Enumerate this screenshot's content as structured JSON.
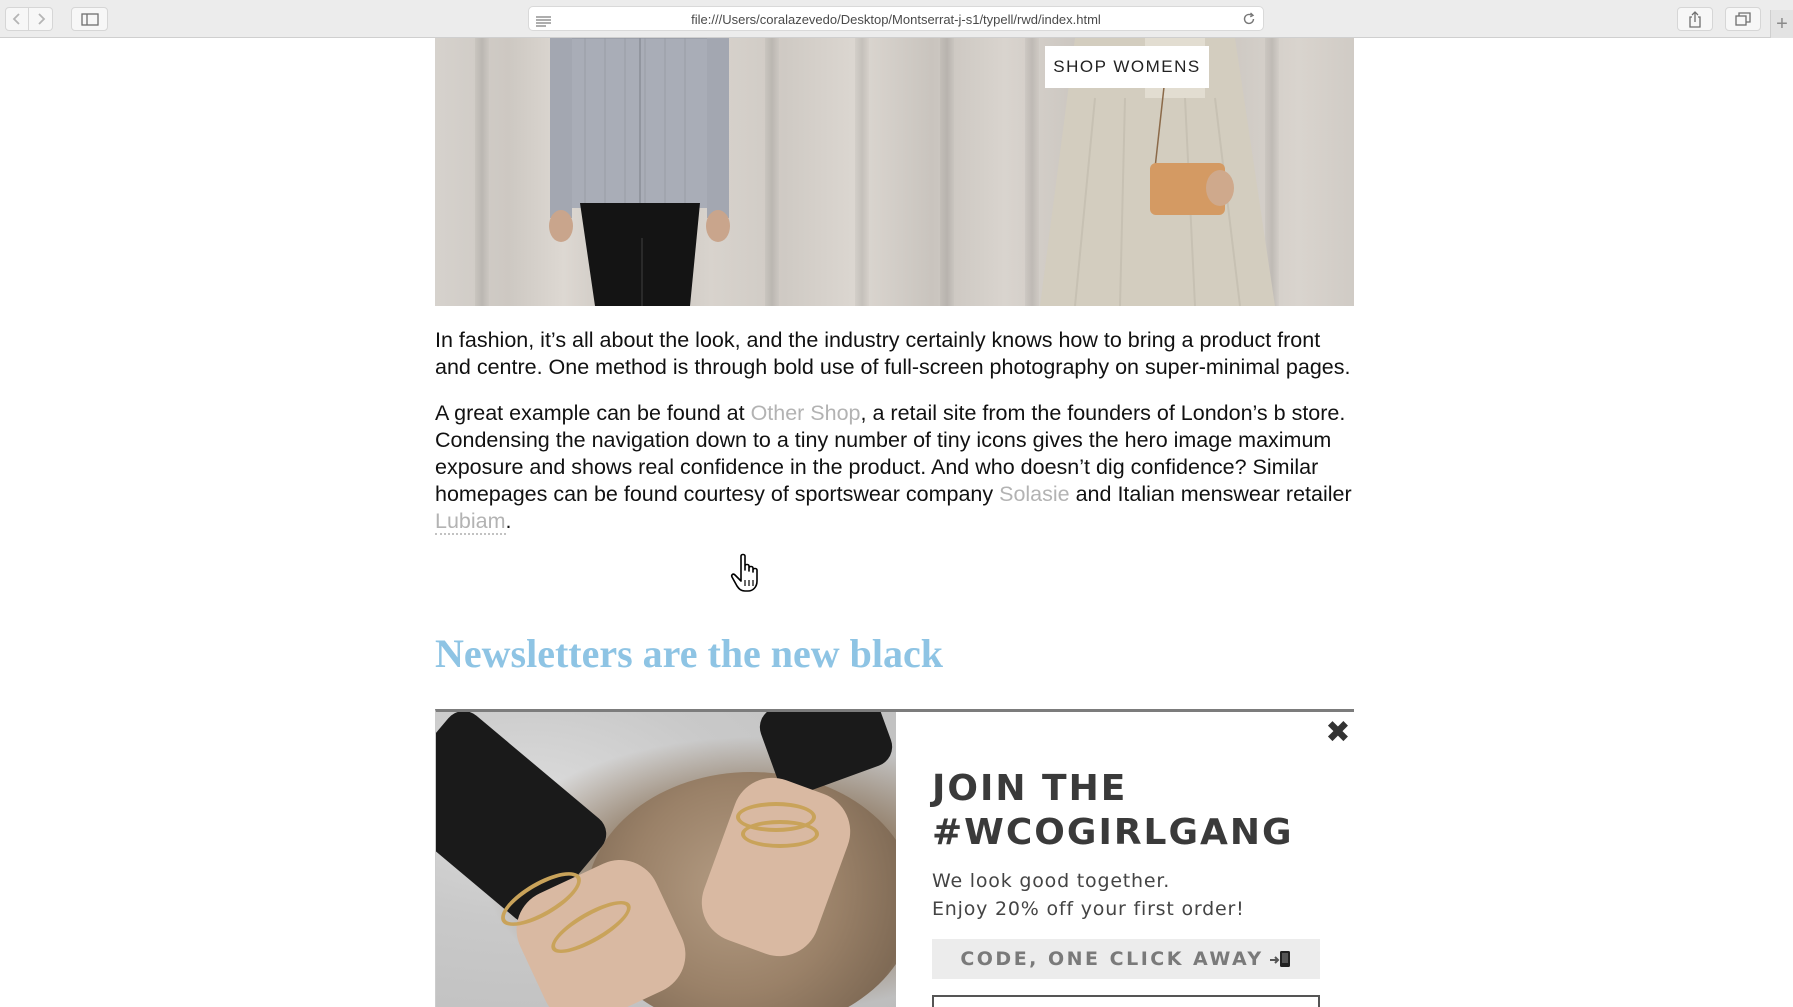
{
  "browser": {
    "url": "file:///Users/coralazevedo/Desktop/Montserrat-j-s1/typell/rwd/index.html",
    "icons": {
      "back": "chevron-left-icon",
      "forward": "chevron-right-icon",
      "sidebar": "sidebar-icon",
      "reader": "reader-icon",
      "reload": "reload-icon",
      "share": "share-icon",
      "tabs": "tabs-icon",
      "new_tab": "plus-icon"
    },
    "new_tab_label": "+"
  },
  "hero": {
    "button_label": "SHOP WOMENS"
  },
  "article": {
    "p1": "In fashion, it’s all about the look, and the industry certainly knows how to bring a product front and centre. One method is through bold use of full-screen photography on super-minimal pages.",
    "p2_a": "A great example can be found at ",
    "p2_link1": "Other Shop",
    "p2_b": ", a retail site from the founders of London’s b store. Condensing the navigation down to a tiny number of tiny icons gives the hero image maximum exposure and shows real confidence in the product. And who doesn’t dig confidence? Similar homepages can be found courtesy of sportswear company ",
    "p2_link2": "Solasie",
    "p2_c": " and Italian menswear retailer ",
    "p2_link3": "Lubiam",
    "p2_d": "."
  },
  "section": {
    "heading": "Newsletters are the new black"
  },
  "popup": {
    "close_label": "✖",
    "title_line1": "JOIN THE",
    "title_line2": "#WCOGIRLGANG",
    "sub_line1": "We look good together.",
    "sub_line2": "Enjoy 20% off your first order!",
    "code_button": "CODE, ONE CLICK AWAY"
  },
  "colors": {
    "heading": "#8ec4e4",
    "link": "#b3b3b3",
    "toolbar": "#ececec"
  }
}
